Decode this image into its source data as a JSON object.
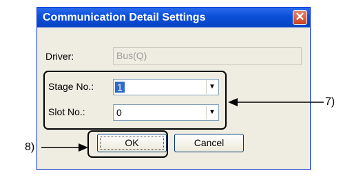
{
  "dialog": {
    "title": "Communication Detail Settings",
    "close_symbol": "✕",
    "driver_label": "Driver:",
    "driver_value": "Bus(Q)",
    "stage_label": "Stage No.:",
    "stage_value": "1",
    "slot_label": "Slot No.:",
    "slot_value": "0",
    "dropdown_arrow": "▼",
    "ok_label": "OK",
    "cancel_label": "Cancel"
  },
  "annotations": {
    "callout_7": "7)",
    "callout_8": "8)"
  },
  "colors": {
    "title_bar": "#0a4fd8",
    "dialog_bg": "#efede2",
    "selection": "#316ac5"
  }
}
